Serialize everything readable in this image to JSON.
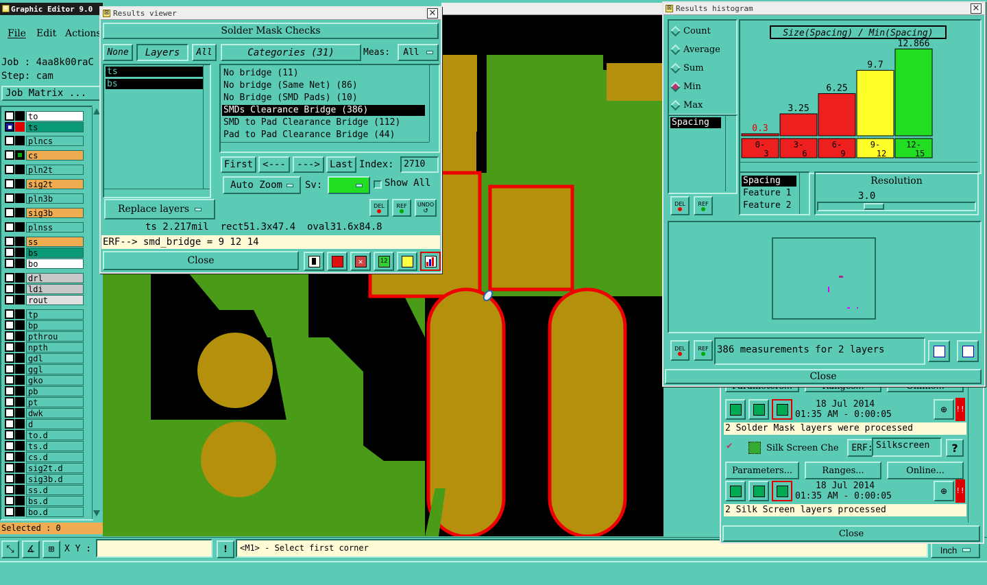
{
  "main_window": {
    "title": "Graphic Editor 9.0",
    "menu": [
      "File",
      "Edit",
      "Actions"
    ],
    "job_label": "Job : 4aa8k00raC",
    "step_label": "Step: cam",
    "job_matrix": "Job Matrix ...",
    "layers": [
      {
        "name": "to",
        "color": "#ffffff"
      },
      {
        "name": "ts",
        "color": "#0a9a78"
      },
      {
        "name": "plncs",
        "color": "#5ccbb6"
      },
      {
        "name": "cs",
        "color": "#f0ac50"
      },
      {
        "name": "pln2t",
        "color": "#5ccbb6"
      },
      {
        "name": "sig2t",
        "color": "#f0ac50"
      },
      {
        "name": "pln3b",
        "color": "#5ccbb6"
      },
      {
        "name": "sig3b",
        "color": "#f0ac50"
      },
      {
        "name": "plnss",
        "color": "#5ccbb6"
      },
      {
        "name": "ss",
        "color": "#f0ac50"
      },
      {
        "name": "bs",
        "color": "#0a9a78"
      },
      {
        "name": "bo",
        "color": "#ffffff"
      },
      {
        "name": "drl",
        "color": "#c8c8c8"
      },
      {
        "name": "ldi",
        "color": "#c8c8c8"
      },
      {
        "name": "rout",
        "color": "#e0e0e0"
      },
      {
        "name": "tp",
        "color": "#5ccbb6"
      },
      {
        "name": "bp",
        "color": "#5ccbb6"
      },
      {
        "name": "pthrou",
        "color": "#5ccbb6"
      },
      {
        "name": "npth",
        "color": "#5ccbb6"
      },
      {
        "name": "gdl",
        "color": "#5ccbb6"
      },
      {
        "name": "ggl",
        "color": "#5ccbb6"
      },
      {
        "name": "gko",
        "color": "#5ccbb6"
      },
      {
        "name": "pb",
        "color": "#5ccbb6"
      },
      {
        "name": "pt",
        "color": "#5ccbb6"
      },
      {
        "name": "dwk",
        "color": "#5ccbb6"
      },
      {
        "name": "d",
        "color": "#5ccbb6"
      },
      {
        "name": "to.d",
        "color": "#5ccbb6"
      },
      {
        "name": "ts.d",
        "color": "#5ccbb6"
      },
      {
        "name": "cs.d",
        "color": "#5ccbb6"
      },
      {
        "name": "sig2t.d",
        "color": "#5ccbb6"
      },
      {
        "name": "sig3b.d",
        "color": "#5ccbb6"
      },
      {
        "name": "ss.d",
        "color": "#5ccbb6"
      },
      {
        "name": "bs.d",
        "color": "#5ccbb6"
      },
      {
        "name": "bo.d",
        "color": "#5ccbb6"
      }
    ],
    "selected": "Selected : 0",
    "xy_label": "X Y :",
    "xy_value": "",
    "status_message": "<M1> - Select first corner",
    "units": "Inch"
  },
  "results_viewer": {
    "title": "Results viewer",
    "header": "Solder Mask Checks",
    "none_btn": "None",
    "layers_btn": "Layers",
    "all_btn": "All",
    "layers": [
      "ts",
      "bs"
    ],
    "categories_btn": "Categories (31)",
    "meas_label": "Meas:",
    "meas_value": "All",
    "categories": [
      "No bridge (11)",
      "No bridge (Same Net) (86)",
      "No Bridge (SMD Pads) (10)",
      "SMDs Clearance Bridge (386)",
      "SMD to Pad Clearance Bridge (112)",
      "Pad to Pad Clearance Bridge (44)"
    ],
    "selected_category_index": 3,
    "first_btn": "First",
    "prev_btn": "<---",
    "next_btn": "--->",
    "last_btn": "Last",
    "index_label": "Index:",
    "index_value": "2710",
    "auto_zoom": "Auto Zoom",
    "sv_label": "Sv:",
    "show_all": "Show All",
    "del_btn": "DEL",
    "ref_btn": "REF",
    "undo_btn": "UNDO",
    "replace_layers": "Replace layers",
    "info_line": "ts 2.217mil  rect51.3x47.4  oval31.6x84.8",
    "erf_line": "ERF--> smd_bridge = 9 12 14",
    "close_btn": "Close"
  },
  "results_histogram": {
    "title": "Results histogram",
    "modes": [
      "Count",
      "Average",
      "Sum",
      "Min",
      "Max"
    ],
    "active_mode": "Min",
    "measure_list": [
      "Spacing"
    ],
    "chart_title": "Size(Spacing) / Min(Spacing)",
    "group_list": [
      "Spacing",
      "Feature 1",
      "Feature 2"
    ],
    "resolution_label": "Resolution",
    "resolution_value": "3.0",
    "del_btn": "DEL",
    "ref_btn": "REF",
    "measurements_text": "386 measurements for 2 layers",
    "close_btn": "Close",
    "colors": {
      "low": "#ee1f1f",
      "mid": "#ffff2a",
      "high": "#22dd22"
    }
  },
  "chart_data": {
    "type": "bar",
    "title": "Size(Spacing) / Min(Spacing)",
    "categories": [
      "0-3",
      "3-6",
      "6-9",
      "9-12",
      "12-15"
    ],
    "values": [
      0.3,
      3.25,
      6.25,
      9.7,
      12.866
    ],
    "value_labels": [
      "0.3",
      "3.25",
      "6.25",
      "9.7",
      "12.866"
    ],
    "bar_colors": [
      "#ee1f1f",
      "#ee1f1f",
      "#ee1f1f",
      "#ffff2a",
      "#22dd22"
    ],
    "ylim": [
      0,
      13
    ],
    "grid": false
  },
  "checklist_panel": {
    "parameters_btn": "Parameters...",
    "ranges_btn": "Ranges...",
    "online_btn": "Online...",
    "run1_date": "18 Jul 2014",
    "run1_time": "01:35 AM - 0:00:05",
    "run1_msg": "2 Solder Mask layers were processed",
    "silk_label": "Silk Screen Che",
    "erf_label": "ERF:",
    "erf_value": "Silkscreen",
    "help_btn": "?",
    "run2_date": "18 Jul 2014",
    "run2_time": "01:35 AM - 0:00:05",
    "run2_msg": "2 Silk Screen layers processed",
    "close_btn": "Close"
  }
}
